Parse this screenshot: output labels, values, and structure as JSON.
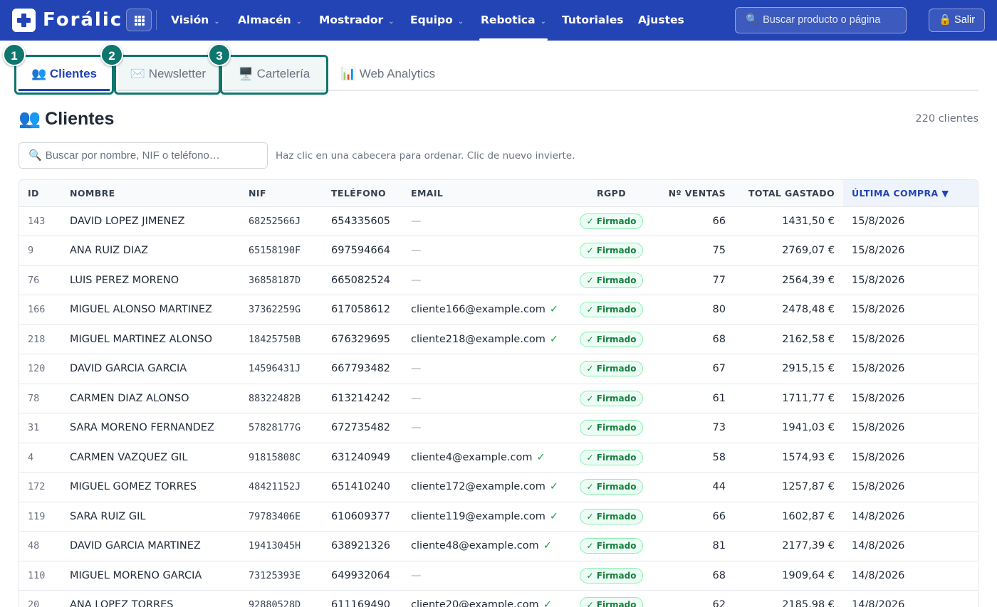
{
  "app": {
    "name": "Forálic"
  },
  "nav": {
    "items": [
      {
        "label": "Visión",
        "has_menu": true
      },
      {
        "label": "Almacén",
        "has_menu": true
      },
      {
        "label": "Mostrador",
        "has_menu": true
      },
      {
        "label": "Equipo",
        "has_menu": true
      },
      {
        "label": "Rebotica",
        "has_menu": true,
        "active": true
      },
      {
        "label": "Tutoriales",
        "has_menu": false
      },
      {
        "label": "Ajustes",
        "has_menu": false
      }
    ],
    "search_placeholder": "Buscar producto o página",
    "search_icon": "🔍",
    "logout_label": "🔒 Salir"
  },
  "tabs": [
    {
      "label": "👥 Clientes",
      "badge": "1",
      "active": true
    },
    {
      "label": "✉️ Newsletter",
      "badge": "2"
    },
    {
      "label": "🖥️ Cartelería",
      "badge": "3"
    },
    {
      "label": "📊 Web Analytics"
    }
  ],
  "page": {
    "title_emoji": "👥",
    "title": "Clientes",
    "count": "220 clientes",
    "search_placeholder": "Buscar por nombre, NIF o teléfono…",
    "search_icon": "🔍",
    "hint": "Haz clic en una cabecera para ordenar. Clic de nuevo invierte."
  },
  "table": {
    "columns": [
      "ID",
      "NOMBRE",
      "NIF",
      "TELÉFONO",
      "EMAIL",
      "RGPD",
      "Nº VENTAS",
      "TOTAL GASTADO",
      "ÚLTIMA COMPRA ▼"
    ],
    "email_check": "✓",
    "rows": [
      {
        "id": "143",
        "nombre": "DAVID LOPEZ JIMENEZ",
        "nif": "68252566J",
        "telefono": "654335605",
        "email": "—",
        "rgpd": "✓ Firmado",
        "ventas": "66",
        "total": "1431,50 €",
        "ultima": "15/8/2026"
      },
      {
        "id": "9",
        "nombre": "ANA RUIZ DIAZ",
        "nif": "65158190F",
        "telefono": "697594664",
        "email": "—",
        "rgpd": "✓ Firmado",
        "ventas": "75",
        "total": "2769,07 €",
        "ultima": "15/8/2026"
      },
      {
        "id": "76",
        "nombre": "LUIS PEREZ MORENO",
        "nif": "36858187D",
        "telefono": "665082524",
        "email": "—",
        "rgpd": "✓ Firmado",
        "ventas": "77",
        "total": "2564,39 €",
        "ultima": "15/8/2026"
      },
      {
        "id": "166",
        "nombre": "MIGUEL ALONSO MARTINEZ",
        "nif": "37362259G",
        "telefono": "617058612",
        "email": "cliente166@example.com",
        "rgpd": "✓ Firmado",
        "ventas": "80",
        "total": "2478,48 €",
        "ultima": "15/8/2026"
      },
      {
        "id": "218",
        "nombre": "MIGUEL MARTINEZ ALONSO",
        "nif": "18425750B",
        "telefono": "676329695",
        "email": "cliente218@example.com",
        "rgpd": "✓ Firmado",
        "ventas": "68",
        "total": "2162,58 €",
        "ultima": "15/8/2026"
      },
      {
        "id": "120",
        "nombre": "DAVID GARCIA GARCIA",
        "nif": "14596431J",
        "telefono": "667793482",
        "email": "—",
        "rgpd": "✓ Firmado",
        "ventas": "67",
        "total": "2915,15 €",
        "ultima": "15/8/2026"
      },
      {
        "id": "78",
        "nombre": "CARMEN DIAZ ALONSO",
        "nif": "88322482B",
        "telefono": "613214242",
        "email": "—",
        "rgpd": "✓ Firmado",
        "ventas": "61",
        "total": "1711,77 €",
        "ultima": "15/8/2026"
      },
      {
        "id": "31",
        "nombre": "SARA MORENO FERNANDEZ",
        "nif": "57828177G",
        "telefono": "672735482",
        "email": "—",
        "rgpd": "✓ Firmado",
        "ventas": "73",
        "total": "1941,03 €",
        "ultima": "15/8/2026"
      },
      {
        "id": "4",
        "nombre": "CARMEN VAZQUEZ GIL",
        "nif": "91815808C",
        "telefono": "631240949",
        "email": "cliente4@example.com",
        "rgpd": "✓ Firmado",
        "ventas": "58",
        "total": "1574,93 €",
        "ultima": "15/8/2026"
      },
      {
        "id": "172",
        "nombre": "MIGUEL GOMEZ TORRES",
        "nif": "48421152J",
        "telefono": "651410240",
        "email": "cliente172@example.com",
        "rgpd": "✓ Firmado",
        "ventas": "44",
        "total": "1257,87 €",
        "ultima": "15/8/2026"
      },
      {
        "id": "119",
        "nombre": "SARA RUIZ GIL",
        "nif": "79783406E",
        "telefono": "610609377",
        "email": "cliente119@example.com",
        "rgpd": "✓ Firmado",
        "ventas": "66",
        "total": "1602,87 €",
        "ultima": "14/8/2026"
      },
      {
        "id": "48",
        "nombre": "DAVID GARCIA MARTINEZ",
        "nif": "19413045H",
        "telefono": "638921326",
        "email": "cliente48@example.com",
        "rgpd": "✓ Firmado",
        "ventas": "81",
        "total": "2177,39 €",
        "ultima": "14/8/2026"
      },
      {
        "id": "110",
        "nombre": "MIGUEL MORENO GARCIA",
        "nif": "73125393E",
        "telefono": "649932064",
        "email": "—",
        "rgpd": "✓ Firmado",
        "ventas": "68",
        "total": "1909,64 €",
        "ultima": "14/8/2026"
      },
      {
        "id": "20",
        "nombre": "ANA LOPEZ TORRES",
        "nif": "92880528D",
        "telefono": "611169490",
        "email": "cliente20@example.com",
        "rgpd": "✓ Firmado",
        "ventas": "62",
        "total": "2185,98 €",
        "ultima": "14/8/2026"
      }
    ]
  },
  "colors": {
    "primary": "#2344b5",
    "highlight": "#0f766e",
    "success": "#15803d"
  }
}
